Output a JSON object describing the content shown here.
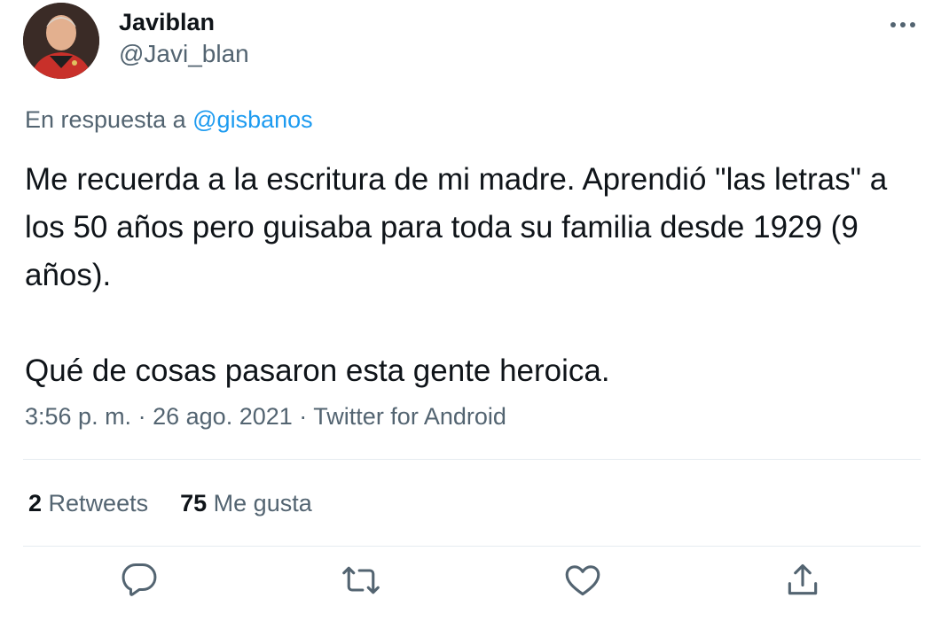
{
  "author": {
    "name": "Javiblan",
    "handle": "@Javi_blan"
  },
  "reply_context": {
    "prefix": "En respuesta a",
    "mention": "@gisbanos"
  },
  "tweet": {
    "paragraph_1": "Me recuerda a la escritura de mi madre. Aprendió \"las letras\" a los 50 años pero guisaba para toda su familia desde 1929 (9 años).",
    "paragraph_2": "Qué de cosas pasaron esta gente heroica.",
    "time": "3:56 p. m.",
    "separator": "·",
    "date": "26 ago. 2021",
    "source": "Twitter for Android"
  },
  "stats": {
    "retweets_count": "2",
    "retweets_label": "Retweets",
    "likes_count": "75",
    "likes_label": "Me gusta"
  },
  "icons": {
    "more": "more-horizontal-icon",
    "reply": "reply-bubble-icon",
    "retweet": "retweet-icon",
    "like": "heart-icon",
    "share": "share-icon"
  },
  "colors": {
    "text": "#0f1419",
    "secondary": "#536471",
    "accent": "#1d9bf0",
    "divider": "#e6ecf0"
  }
}
